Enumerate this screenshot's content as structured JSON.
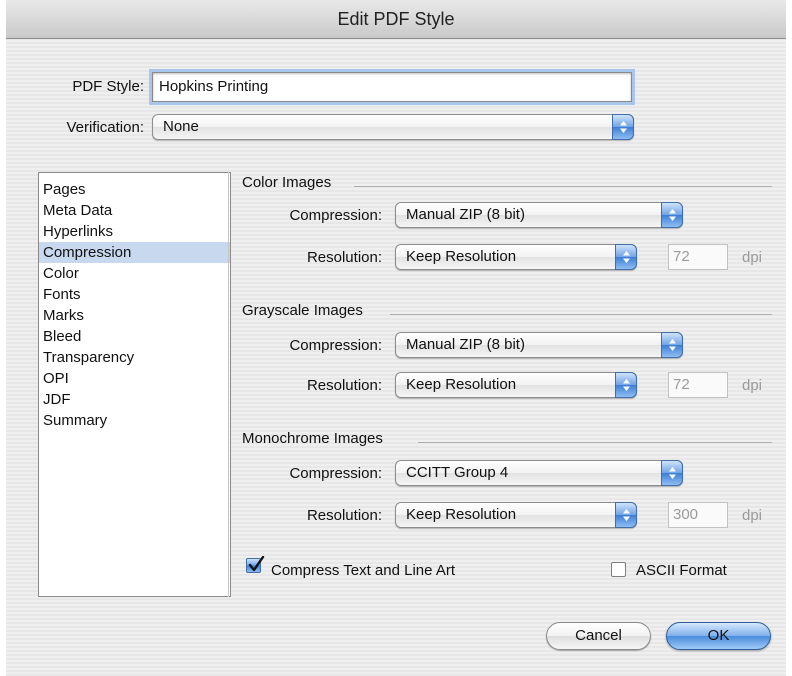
{
  "window": {
    "title": "Edit PDF Style"
  },
  "header": {
    "pdf_style_label": "PDF Style:",
    "pdf_style_value": "Hopkins Printing",
    "verification_label": "Verification:",
    "verification_value": "None"
  },
  "sidebar": {
    "items": [
      {
        "label": "Pages"
      },
      {
        "label": "Meta Data"
      },
      {
        "label": "Hyperlinks"
      },
      {
        "label": "Compression",
        "selected": true
      },
      {
        "label": "Color"
      },
      {
        "label": "Fonts"
      },
      {
        "label": "Marks"
      },
      {
        "label": "Bleed"
      },
      {
        "label": "Transparency"
      },
      {
        "label": "OPI"
      },
      {
        "label": "JDF"
      },
      {
        "label": "Summary"
      }
    ]
  },
  "groups": {
    "color": {
      "title": "Color Images",
      "compression_label": "Compression:",
      "compression_value": "Manual ZIP (8 bit)",
      "resolution_label": "Resolution:",
      "resolution_value": "Keep Resolution",
      "dpi_value": "72",
      "dpi_unit": "dpi"
    },
    "grayscale": {
      "title": "Grayscale Images",
      "compression_label": "Compression:",
      "compression_value": "Manual ZIP (8 bit)",
      "resolution_label": "Resolution:",
      "resolution_value": "Keep Resolution",
      "dpi_value": "72",
      "dpi_unit": "dpi"
    },
    "monochrome": {
      "title": "Monochrome Images",
      "compression_label": "Compression:",
      "compression_value": "CCITT Group 4",
      "resolution_label": "Resolution:",
      "resolution_value": "Keep Resolution",
      "dpi_value": "300",
      "dpi_unit": "dpi"
    }
  },
  "options": {
    "compress_text_label": "Compress Text and Line Art",
    "compress_text_checked": true,
    "ascii_format_label": "ASCII Format",
    "ascii_format_checked": false
  },
  "buttons": {
    "cancel_label": "Cancel",
    "ok_label": "OK"
  },
  "colors": {
    "accent": "#4a8cdb",
    "selection": "#c8d8ee",
    "focus_ring": "#a8c6ec"
  }
}
